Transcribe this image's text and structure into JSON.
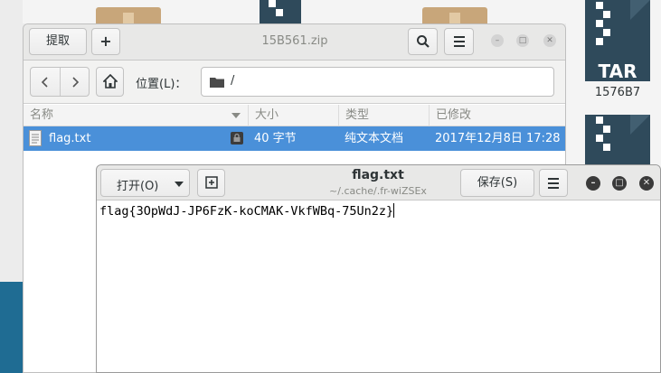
{
  "desktop": {
    "tar_label": "TAR",
    "tar_caption": "1576B7"
  },
  "archive": {
    "title": "15B561.zip",
    "extract_label": "提取",
    "add_label": "+",
    "location_label": "位置(L)：",
    "location_value": "/",
    "columns": {
      "name": "名称",
      "size": "大小",
      "type": "类型",
      "modified": "已修改"
    },
    "file": {
      "name": "flag.txt",
      "size": "40 字节",
      "type": "纯文本文档",
      "modified": "2017年12月8日 17:28"
    }
  },
  "editor": {
    "open_label": "打开(O)",
    "title": "flag.txt",
    "subtitle": "~/.cache/.fr-wiZSEx",
    "save_label": "保存(S)",
    "content": "flag{3OpWdJ-JP6FzK-koCMAK-VkfWBq-75Un2z}"
  },
  "colors": {
    "selection": "#4a90d9",
    "headerbar": "#e8e8e7"
  }
}
